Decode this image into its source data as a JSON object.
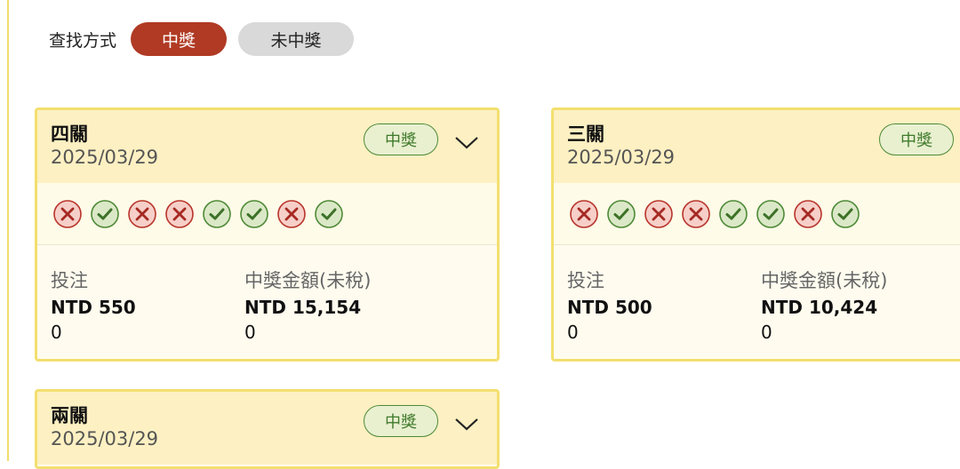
{
  "filter": {
    "label": "查找方式",
    "options": [
      {
        "label": "中獎",
        "active": true
      },
      {
        "label": "未中獎",
        "active": false
      }
    ]
  },
  "cards": [
    {
      "title": "四關",
      "date": "2025/03/29",
      "status": "中獎",
      "results": [
        "lose",
        "win",
        "lose",
        "lose",
        "win",
        "win",
        "lose",
        "win"
      ],
      "stake_label": "投注",
      "stake_value": "NTD 550",
      "stake_sub": "0",
      "prize_label": "中獎金額(未稅)",
      "prize_value": "NTD 15,154",
      "prize_sub": "0"
    },
    {
      "title": "三關",
      "date": "2025/03/29",
      "status": "中獎",
      "results": [
        "lose",
        "win",
        "lose",
        "lose",
        "win",
        "win",
        "lose",
        "win"
      ],
      "stake_label": "投注",
      "stake_value": "NTD 500",
      "stake_sub": "0",
      "prize_label": "中獎金額(未稅)",
      "prize_value": "NTD 10,424",
      "prize_sub": "0"
    },
    {
      "title": "兩關",
      "date": "2025/03/29",
      "status": "中獎"
    }
  ],
  "colors": {
    "accent_red": "#b03a24",
    "card_border": "#f3df6f",
    "win_green": "#4e8a37",
    "lose_red": "#b8352b"
  },
  "icons": {
    "win": "check-circle-icon",
    "lose": "x-circle-icon",
    "expand": "chevron-down-icon"
  }
}
